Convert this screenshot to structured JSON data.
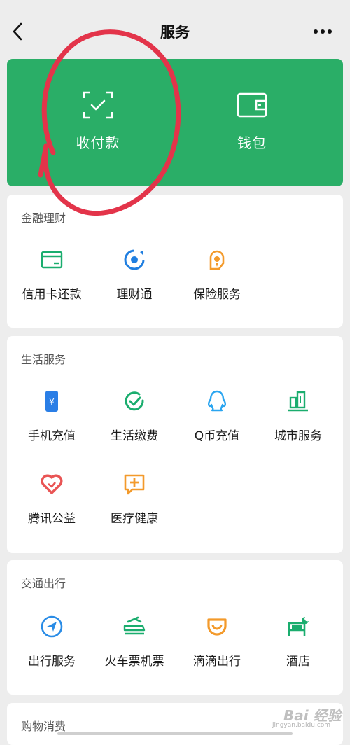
{
  "header": {
    "title": "服务"
  },
  "hero": {
    "items": [
      {
        "label": "收付款",
        "icon": "scan-pay-icon"
      },
      {
        "label": "钱包",
        "icon": "wallet-icon"
      }
    ]
  },
  "sections": [
    {
      "title": "金融理财",
      "items": [
        {
          "label": "信用卡还款",
          "icon": "credit-card-icon",
          "color": "#1aad6e"
        },
        {
          "label": "理财通",
          "icon": "licaitong-icon",
          "color": "#1f7ee0"
        },
        {
          "label": "保险服务",
          "icon": "insurance-icon",
          "color": "#f39a2b"
        }
      ]
    },
    {
      "title": "生活服务",
      "items": [
        {
          "label": "手机充值",
          "icon": "phone-recharge-icon",
          "color": "#2a7ee6"
        },
        {
          "label": "生活缴费",
          "icon": "utility-payment-icon",
          "color": "#1aad6e"
        },
        {
          "label": "Q币充值",
          "icon": "qq-coin-icon",
          "color": "#2aa5f0"
        },
        {
          "label": "城市服务",
          "icon": "city-service-icon",
          "color": "#1aad6e"
        },
        {
          "label": "腾讯公益",
          "icon": "charity-heart-icon",
          "color": "#e95454"
        },
        {
          "label": "医疗健康",
          "icon": "medical-icon",
          "color": "#f39a2b"
        }
      ]
    },
    {
      "title": "交通出行",
      "items": [
        {
          "label": "出行服务",
          "icon": "travel-navigation-icon",
          "color": "#2a8ce6"
        },
        {
          "label": "火车票机票",
          "icon": "train-ticket-icon",
          "color": "#1aad6e"
        },
        {
          "label": "滴滴出行",
          "icon": "didi-icon",
          "color": "#f39a2b"
        },
        {
          "label": "酒店",
          "icon": "hotel-icon",
          "color": "#1aad6e"
        }
      ]
    },
    {
      "title": "购物消费"
    }
  ],
  "annotation": {
    "color": "#e3344a"
  },
  "watermark": {
    "text": "Bai 经验",
    "url": "jingyan.baidu.com"
  }
}
